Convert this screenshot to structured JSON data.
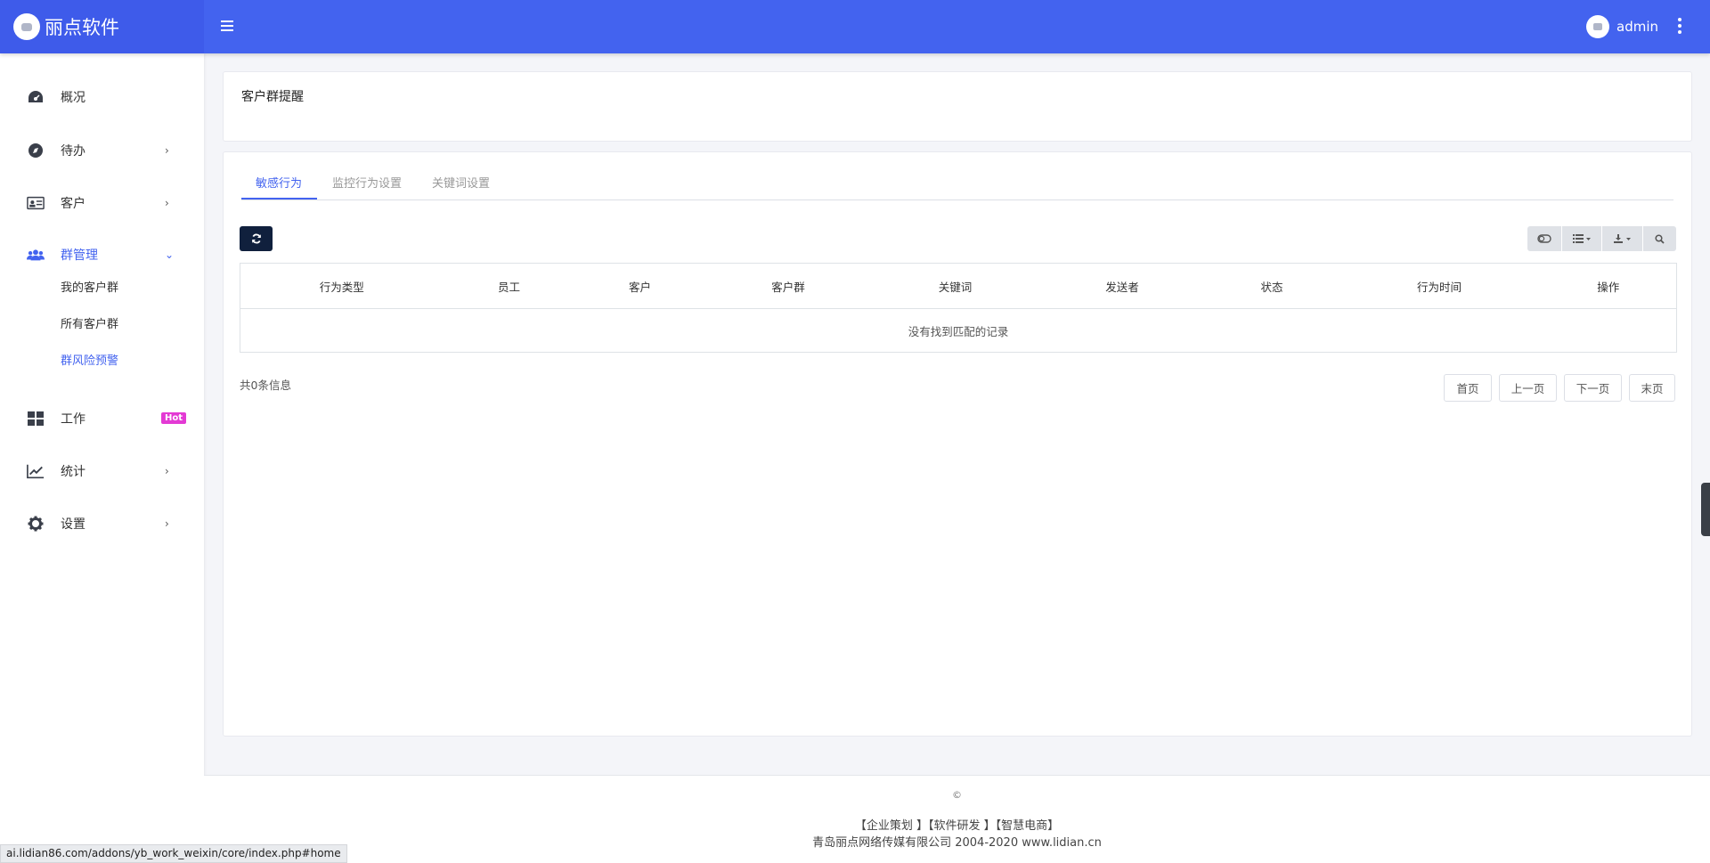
{
  "header": {
    "brand": "丽点软件",
    "user_name": "admin"
  },
  "sidebar": {
    "items": [
      {
        "label": "概况",
        "icon": "dashboard-icon"
      },
      {
        "label": "待办",
        "icon": "compass-icon"
      },
      {
        "label": "客户",
        "icon": "id-card-icon"
      },
      {
        "label": "群管理",
        "icon": "users-icon"
      },
      {
        "label": "工作",
        "icon": "grid-icon",
        "badge": "Hot"
      },
      {
        "label": "统计",
        "icon": "line-chart-icon"
      },
      {
        "label": "设置",
        "icon": "gear-icon"
      }
    ],
    "subitems": [
      "我的客户群",
      "所有客户群",
      "群风险预警"
    ]
  },
  "page_title": "客户群提醒",
  "tabs": [
    "敏感行为",
    "监控行为设置",
    "关键词设置"
  ],
  "table": {
    "columns": [
      "行为类型",
      "员工",
      "客户",
      "客户群",
      "关键词",
      "发送者",
      "状态",
      "行为时间",
      "操作"
    ],
    "empty_text": "没有找到匹配的记录"
  },
  "total_text": "共0条信息",
  "pager": [
    "首页",
    "上一页",
    "下一页",
    "末页"
  ],
  "footer": {
    "copyright": "©",
    "links": "【企业策划 】【软件研发 】【智慧电商】",
    "company": "青岛丽点网络传媒有限公司 2004-2020 www.lidian.cn"
  },
  "status_url": "ai.lidian86.com/addons/yb_work_weixin/core/index.php#home",
  "colors": {
    "primary": "#4363ef",
    "hot_badge": "#e33ad4",
    "refresh_btn": "#10203d"
  }
}
